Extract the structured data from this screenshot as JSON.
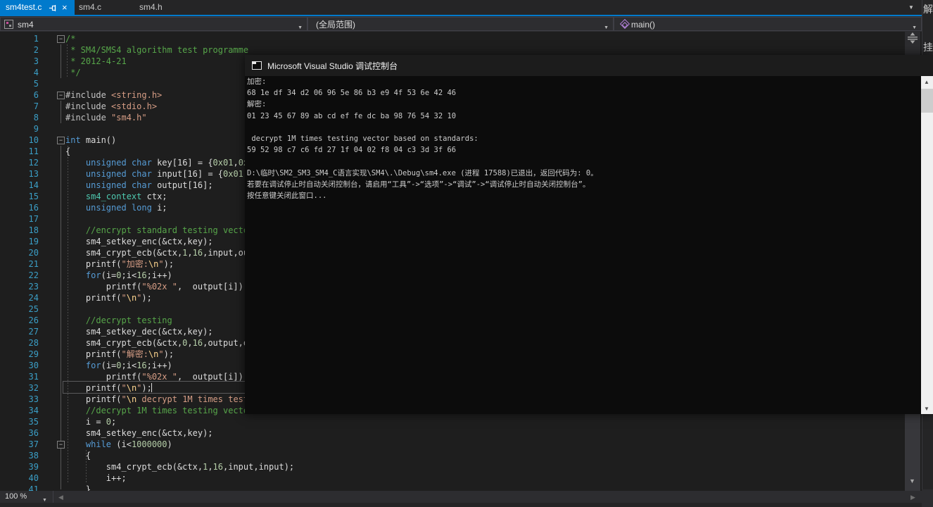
{
  "tabs": {
    "active": "sm4test.c",
    "tab2": "sm4.c",
    "tab3": "sm4.h",
    "close_glyph": "×"
  },
  "navbar": {
    "project": "sm4",
    "scope": "(全局范围)",
    "member": "main()"
  },
  "statusbar": {
    "zoom_level": "100 %"
  },
  "right_strip": {
    "char_top": "解",
    "char_mid": "挂"
  },
  "colors": {
    "accent": "#007acc",
    "editor_bg": "#1e1e1e",
    "console_bg": "#0c0c0c",
    "keyword": "#569cd6",
    "comment": "#57a64a",
    "string": "#d69d85",
    "number": "#b5cea8",
    "type": "#4ec9b0",
    "line_number": "#3b9fc7"
  },
  "editor": {
    "lines": [
      {
        "n": 1,
        "fold": true,
        "t": [
          [
            "cm",
            "/*"
          ]
        ]
      },
      {
        "n": 2,
        "t": [
          [
            "cm",
            " * SM4/SMS4 algorithm test programme"
          ]
        ]
      },
      {
        "n": 3,
        "t": [
          [
            "cm",
            " * 2012-4-21"
          ]
        ]
      },
      {
        "n": 4,
        "t": [
          [
            "cm",
            " */"
          ]
        ]
      },
      {
        "n": 5,
        "t": []
      },
      {
        "n": 6,
        "fold": true,
        "t": [
          [
            "pp",
            "#include "
          ],
          [
            "str",
            "<string.h>"
          ]
        ]
      },
      {
        "n": 7,
        "t": [
          [
            "pp",
            "#include "
          ],
          [
            "str",
            "<stdio.h>"
          ]
        ]
      },
      {
        "n": 8,
        "t": [
          [
            "pp",
            "#include "
          ],
          [
            "str",
            "\"sm4.h\""
          ]
        ]
      },
      {
        "n": 9,
        "t": []
      },
      {
        "n": 10,
        "fold": true,
        "t": [
          [
            "kw",
            "int"
          ],
          [
            "pl",
            " main()"
          ]
        ]
      },
      {
        "n": 11,
        "t": [
          [
            "pl",
            "{"
          ]
        ]
      },
      {
        "n": 12,
        "t": [
          [
            "pl",
            "    "
          ],
          [
            "kw",
            "unsigned"
          ],
          [
            "pl",
            " "
          ],
          [
            "kw",
            "char"
          ],
          [
            "pl",
            " key[16] = {"
          ],
          [
            "num",
            "0x01"
          ],
          [
            "pl",
            ","
          ],
          [
            "num",
            "0x"
          ]
        ]
      },
      {
        "n": 13,
        "t": [
          [
            "pl",
            "    "
          ],
          [
            "kw",
            "unsigned"
          ],
          [
            "pl",
            " "
          ],
          [
            "kw",
            "char"
          ],
          [
            "pl",
            " input[16] = {"
          ],
          [
            "num",
            "0x01"
          ],
          [
            "pl",
            ","
          ]
        ]
      },
      {
        "n": 14,
        "t": [
          [
            "pl",
            "    "
          ],
          [
            "kw",
            "unsigned"
          ],
          [
            "pl",
            " "
          ],
          [
            "kw",
            "char"
          ],
          [
            "pl",
            " output[16];"
          ]
        ]
      },
      {
        "n": 15,
        "t": [
          [
            "pl",
            "    "
          ],
          [
            "ty",
            "sm4_context"
          ],
          [
            "pl",
            " ctx;"
          ]
        ]
      },
      {
        "n": 16,
        "t": [
          [
            "pl",
            "    "
          ],
          [
            "kw",
            "unsigned"
          ],
          [
            "pl",
            " "
          ],
          [
            "kw",
            "long"
          ],
          [
            "pl",
            " i;"
          ]
        ]
      },
      {
        "n": 17,
        "t": []
      },
      {
        "n": 18,
        "t": [
          [
            "pl",
            "    "
          ],
          [
            "cm",
            "//encrypt standard testing vecto"
          ]
        ]
      },
      {
        "n": 19,
        "t": [
          [
            "pl",
            "    sm4_setkey_enc(&ctx,key);"
          ]
        ]
      },
      {
        "n": 20,
        "t": [
          [
            "pl",
            "    sm4_crypt_ecb(&ctx,"
          ],
          [
            "num",
            "1"
          ],
          [
            "pl",
            ","
          ],
          [
            "num",
            "16"
          ],
          [
            "pl",
            ",input,ou"
          ]
        ]
      },
      {
        "n": 21,
        "t": [
          [
            "pl",
            "    printf("
          ],
          [
            "str",
            "\"加密:"
          ],
          [
            "esc",
            "\\n"
          ],
          [
            "str",
            "\""
          ],
          [
            "pl",
            ");"
          ]
        ]
      },
      {
        "n": 22,
        "t": [
          [
            "pl",
            "    "
          ],
          [
            "kw",
            "for"
          ],
          [
            "pl",
            "(i="
          ],
          [
            "num",
            "0"
          ],
          [
            "pl",
            ";i<"
          ],
          [
            "num",
            "16"
          ],
          [
            "pl",
            ";i++)"
          ]
        ]
      },
      {
        "n": 23,
        "t": [
          [
            "pl",
            "        printf("
          ],
          [
            "str",
            "\"%02x \""
          ],
          [
            "pl",
            ",  output[i]);"
          ]
        ]
      },
      {
        "n": 24,
        "t": [
          [
            "pl",
            "    printf("
          ],
          [
            "str",
            "\""
          ],
          [
            "esc",
            "\\n"
          ],
          [
            "str",
            "\""
          ],
          [
            "pl",
            ");"
          ]
        ]
      },
      {
        "n": 25,
        "t": []
      },
      {
        "n": 26,
        "t": [
          [
            "pl",
            "    "
          ],
          [
            "cm",
            "//decrypt testing"
          ]
        ]
      },
      {
        "n": 27,
        "t": [
          [
            "pl",
            "    sm4_setkey_dec(&ctx,key);"
          ]
        ]
      },
      {
        "n": 28,
        "t": [
          [
            "pl",
            "    sm4_crypt_ecb(&ctx,"
          ],
          [
            "num",
            "0"
          ],
          [
            "pl",
            ","
          ],
          [
            "num",
            "16"
          ],
          [
            "pl",
            ",output,o"
          ]
        ]
      },
      {
        "n": 29,
        "t": [
          [
            "pl",
            "    printf("
          ],
          [
            "str",
            "\"解密:"
          ],
          [
            "esc",
            "\\n"
          ],
          [
            "str",
            "\""
          ],
          [
            "pl",
            ");"
          ]
        ]
      },
      {
        "n": 30,
        "t": [
          [
            "pl",
            "    "
          ],
          [
            "kw",
            "for"
          ],
          [
            "pl",
            "(i="
          ],
          [
            "num",
            "0"
          ],
          [
            "pl",
            ";i<"
          ],
          [
            "num",
            "16"
          ],
          [
            "pl",
            ";i++)"
          ]
        ]
      },
      {
        "n": 31,
        "t": [
          [
            "pl",
            "        printf("
          ],
          [
            "str",
            "\"%02x \""
          ],
          [
            "pl",
            ",  output[i]);"
          ]
        ]
      },
      {
        "n": 32,
        "current": true,
        "t": [
          [
            "pl",
            "    printf("
          ],
          [
            "str",
            "\""
          ],
          [
            "esc",
            "\\n"
          ],
          [
            "str",
            "\""
          ],
          [
            "pl",
            ");"
          ]
        ]
      },
      {
        "n": 33,
        "t": [
          [
            "pl",
            "    printf("
          ],
          [
            "str",
            "\""
          ],
          [
            "esc",
            "\\n"
          ],
          [
            "str",
            " decrypt 1M times test"
          ]
        ]
      },
      {
        "n": 34,
        "t": [
          [
            "pl",
            "    "
          ],
          [
            "cm",
            "//decrypt 1M times testing vecto"
          ]
        ]
      },
      {
        "n": 35,
        "t": [
          [
            "pl",
            "    i = "
          ],
          [
            "num",
            "0"
          ],
          [
            "pl",
            ";"
          ]
        ]
      },
      {
        "n": 36,
        "t": [
          [
            "pl",
            "    sm4_setkey_enc(&ctx,key);"
          ]
        ]
      },
      {
        "n": 37,
        "fold": true,
        "t": [
          [
            "pl",
            "    "
          ],
          [
            "kw",
            "while"
          ],
          [
            "pl",
            " (i<"
          ],
          [
            "num",
            "1000000"
          ],
          [
            "pl",
            ")"
          ]
        ]
      },
      {
        "n": 38,
        "t": [
          [
            "pl",
            "    {"
          ]
        ]
      },
      {
        "n": 39,
        "t": [
          [
            "pl",
            "        sm4_crypt_ecb(&ctx,"
          ],
          [
            "num",
            "1"
          ],
          [
            "pl",
            ","
          ],
          [
            "num",
            "16"
          ],
          [
            "pl",
            ",input,input);"
          ]
        ]
      },
      {
        "n": 40,
        "t": [
          [
            "pl",
            "        i++;"
          ]
        ]
      },
      {
        "n": 41,
        "t": [
          [
            "pl",
            "    }"
          ]
        ]
      }
    ]
  },
  "console": {
    "title": "Microsoft Visual Studio 调试控制台",
    "lines": [
      "加密:",
      "68 1e df 34 d2 06 96 5e 86 b3 e9 4f 53 6e 42 46",
      "解密:",
      "01 23 45 67 89 ab cd ef fe dc ba 98 76 54 32 10",
      "",
      " decrypt 1M times testing vector based on standards:",
      "59 52 98 c7 c6 fd 27 1f 04 02 f8 04 c3 3d 3f 66",
      "",
      "D:\\临时\\SM2_SM3_SM4_C语言实现\\SM4\\.\\Debug\\sm4.exe (进程 17588)已退出，返回代码为: 0。",
      "若要在调试停止时自动关闭控制台，请启用“工具”->“选项”->“调试”->“调试停止时自动关闭控制台”。",
      "按任意键关闭此窗口..."
    ]
  }
}
